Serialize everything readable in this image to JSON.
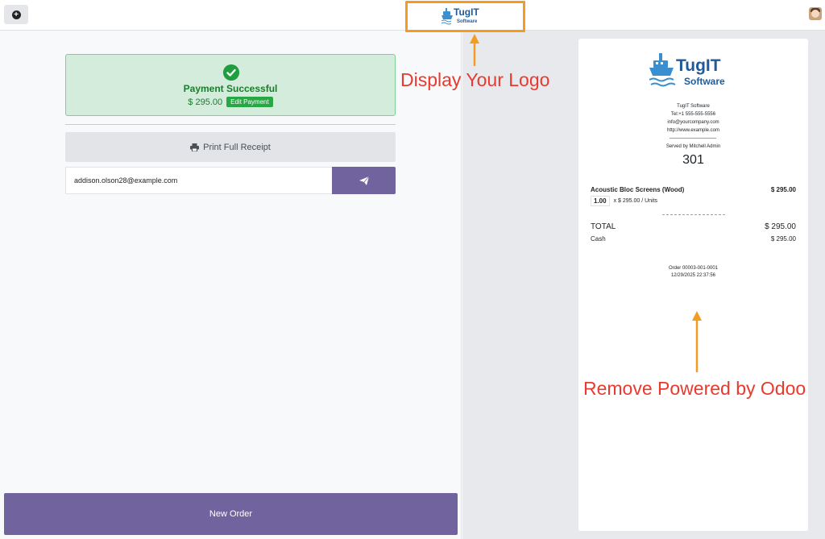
{
  "brand": {
    "name": "TugIT",
    "tagline": "Software",
    "color": "#1f5b9b",
    "ship_color": "#3a8fd1"
  },
  "topbar": {
    "add_icon": "plus-circle-icon",
    "avatar_icon": "user-avatar"
  },
  "payment": {
    "status_icon": "check-circle-icon",
    "status": "Payment Successful",
    "amount": "$ 295.00",
    "edit_label": "Edit Payment",
    "print_icon": "printer-icon",
    "print_label": "Print Full Receipt",
    "email_value": "addison.olson28@example.com",
    "send_icon": "paper-plane-icon"
  },
  "new_order_label": "New Order",
  "receipt": {
    "company": "TugIT Software",
    "tel": "Tel:+1 555-555-5556",
    "email": "info@yourcompany.com",
    "website": "http://www.example.com",
    "served_by": "Served by Mitchell Admin",
    "order_number": "301",
    "line": {
      "product": "Acoustic Bloc Screens (Wood)",
      "price": "$ 295.00",
      "qty": "1.00",
      "unit_price": "x $ 295.00 / Units"
    },
    "total_label": "TOTAL",
    "total_value": "$ 295.00",
    "payment_method": "Cash",
    "payment_value": "$ 295.00",
    "order_ref": "Order 00003-001-0001",
    "datetime": "12/29/2025 22:37:56"
  },
  "annotations": {
    "logo_note": "Display Your Logo",
    "powered_note": "Remove Powered by Odoo",
    "highlight_color": "#f39c1f",
    "text_color": "#e83a2e"
  },
  "colors": {
    "primary": "#71639e",
    "success_bg": "#d4ecdb",
    "success_text": "#1a7c2e",
    "success_badge": "#28a745"
  }
}
